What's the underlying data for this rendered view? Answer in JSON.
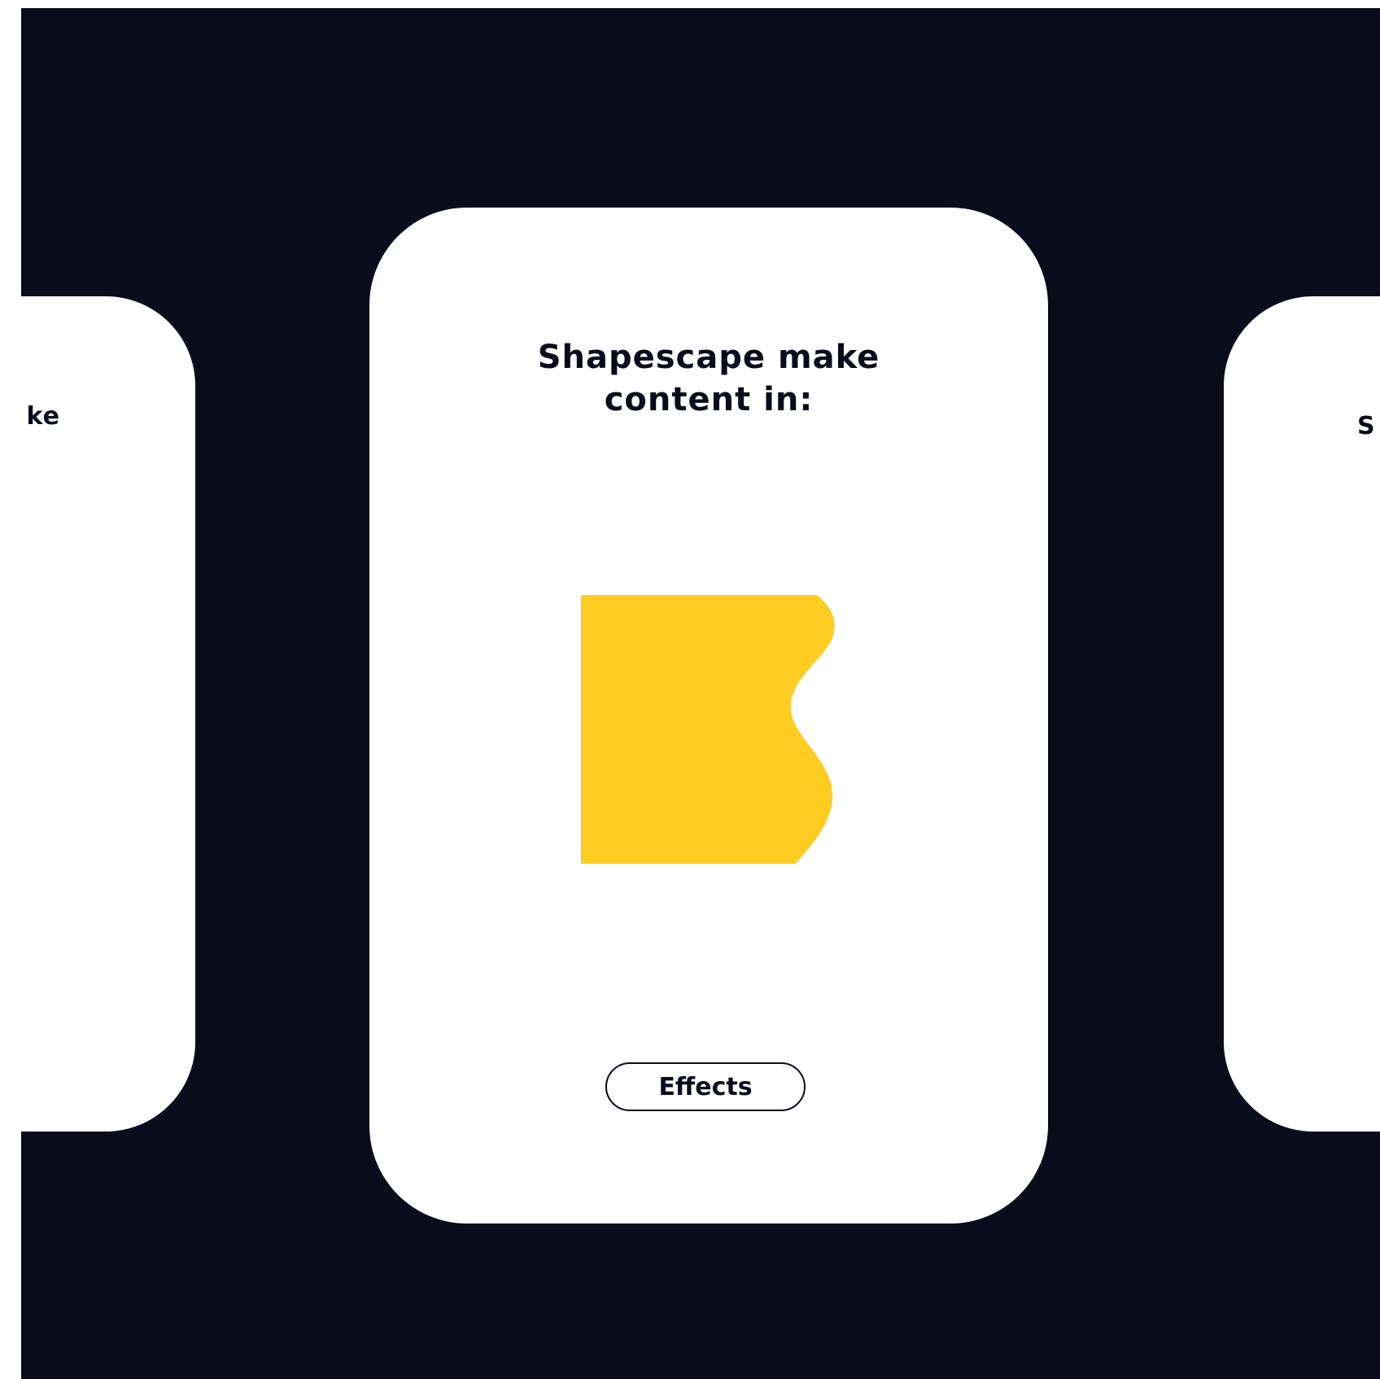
{
  "colors": {
    "background": "#0a0c1c",
    "card": "#ffffff",
    "shape": "#ffcd22",
    "text": "#0a0c1c"
  },
  "cards": {
    "left": {
      "title_fragment": "ke"
    },
    "center": {
      "title": "Shapescape make\ncontent in:",
      "shape": "yellow-wavy-square",
      "button_label": "Effects"
    },
    "right": {
      "title_fragment": "S"
    }
  }
}
